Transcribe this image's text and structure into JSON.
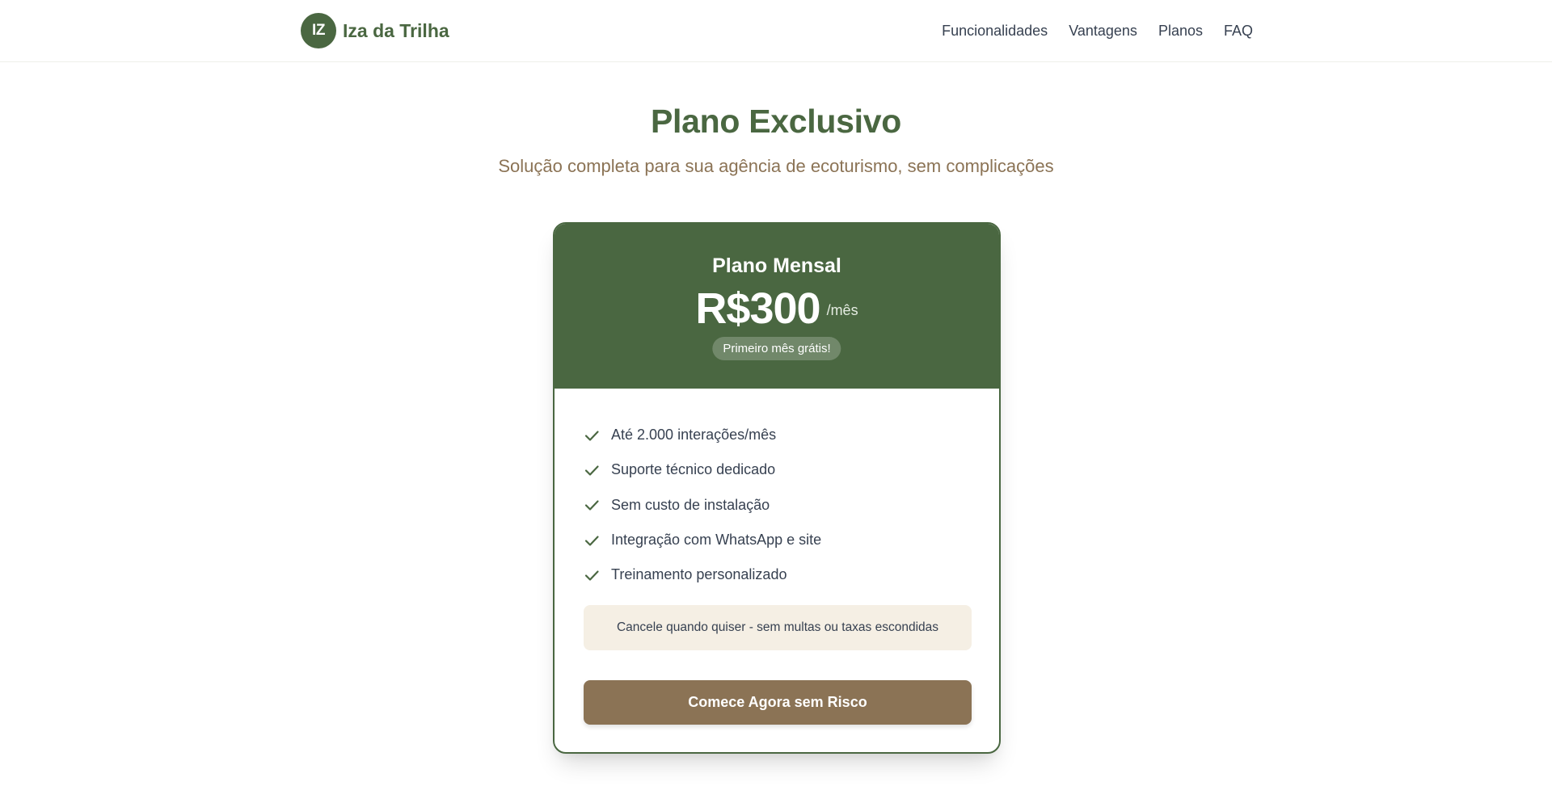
{
  "header": {
    "logo_initials": "IZ",
    "brand_name": "Iza da Trilha",
    "nav": [
      {
        "label": "Funcionalidades"
      },
      {
        "label": "Vantagens"
      },
      {
        "label": "Planos"
      },
      {
        "label": "FAQ"
      }
    ]
  },
  "section": {
    "title": "Plano Exclusivo",
    "subtitle": "Solução completa para sua agência de ecoturismo, sem complicações"
  },
  "plan": {
    "name": "Plano Mensal",
    "price": "R$300",
    "period": "/mês",
    "promo_badge": "Primeiro mês grátis!",
    "features": [
      {
        "icon": "check-icon",
        "text": "Até 2.000 interações/mês"
      },
      {
        "icon": "check-icon",
        "text": "Suporte técnico dedicado"
      },
      {
        "icon": "check-icon",
        "text": "Sem custo de instalação"
      },
      {
        "icon": "check-icon",
        "text": "Integração com WhatsApp e site"
      },
      {
        "icon": "check-icon",
        "text": "Treinamento personalizado"
      }
    ],
    "notice": "Cancele quando quiser - sem multas ou taxas escondidas",
    "cta_label": "Comece Agora sem Risco"
  },
  "colors": {
    "primary_green": "#4a6741",
    "accent_brown": "#8b7355",
    "notice_bg": "#f5efe4",
    "text": "#374151"
  }
}
